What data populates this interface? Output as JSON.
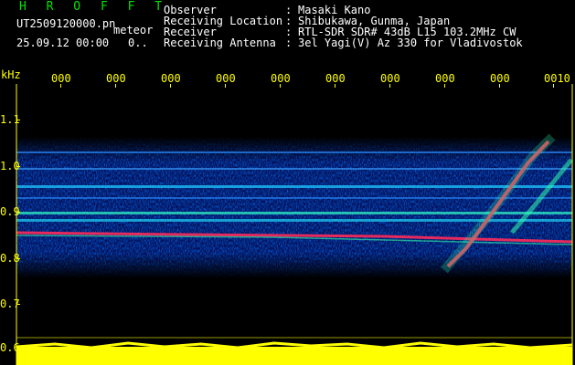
{
  "header": {
    "brand": "H R O F F T",
    "filename": "UT2509120000.pn",
    "type_label": "meteor",
    "datetime": "25.09.12 00:00",
    "counter": "0.."
  },
  "info": [
    {
      "key": "Observer",
      "value": "Masaki Kano"
    },
    {
      "key": "Receiving Location",
      "value": "Shibukawa, Gunma, Japan"
    },
    {
      "key": "Receiver",
      "value": "RTL-SDR SDR# 43dB L15 103.2MHz CW"
    },
    {
      "key": "Receiving Antenna",
      "value": "3el Yagi(V) Az 330 for Vladivostok"
    }
  ],
  "axis": {
    "y_unit": "kHz",
    "y_ticks": [
      "1.1",
      "1.0",
      "0.9",
      "0.8",
      "0.7",
      "0.6"
    ],
    "x_ticks": [
      "000",
      "000",
      "000",
      "000",
      "000",
      "000",
      "000",
      "000",
      "000",
      "0010"
    ]
  },
  "colors": {
    "background": "#000000",
    "axis": "#ffff00",
    "brand": "#00e600",
    "text": "#ffffff"
  }
}
